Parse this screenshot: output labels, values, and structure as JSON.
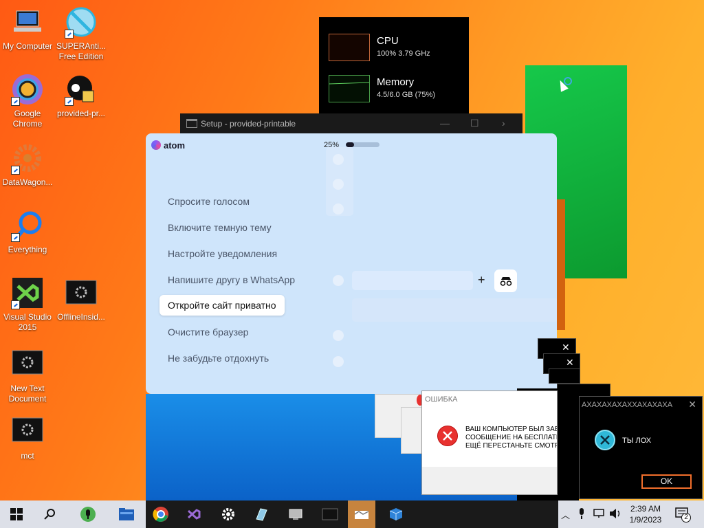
{
  "desktop": {
    "icons": [
      {
        "label": "My Computer"
      },
      {
        "label": "SUPERAnti... Free Edition"
      },
      {
        "label": "Google Chrome"
      },
      {
        "label": "provided-pr..."
      },
      {
        "label": "DataWagon..."
      },
      {
        "label": "Everything"
      },
      {
        "label": "Visual Studio 2015"
      },
      {
        "label": "OfflineInsid..."
      },
      {
        "label": "New Text Document"
      },
      {
        "label": "mct"
      }
    ]
  },
  "task_manager": {
    "cpu": {
      "title": "CPU",
      "detail": "100%  3.79 GHz"
    },
    "memory": {
      "title": "Memory",
      "detail": "4.5/6.0 GB (75%)"
    }
  },
  "setup_window": {
    "title": "Setup - provided-printable"
  },
  "atom": {
    "brand": "atom",
    "progress_label": "25%",
    "progress_value": 25,
    "tips": [
      "Спросите голосом",
      "Включите темную тему",
      "Настройте уведомления",
      "Напишите другу в WhatsApp",
      "Откройте сайт приватно",
      "Очистите браузер",
      "Не забудьте отдохнуть"
    ],
    "active_tip": 4
  },
  "error_dialog": {
    "title": "ОШИБКА",
    "message_lines": [
      "ВАШ КОМПЬЮТЕР БЫЛ ЗАБЛОКИ",
      "СООБЩЕНИЕ НА БЕСПЛАТНЫЙ",
      "ЕЩЁ ПЕРЕСТАНЬТЕ СМОТРЕТЬ П"
    ]
  },
  "laugh_dialog": {
    "title": "АХАХАХАХАХХАХАХАХА",
    "message": "ТЫ ЛОХ",
    "ok_label": "OK"
  },
  "taskbar": {
    "time": "2:39 AM",
    "date": "1/9/2023",
    "notification_count": "2"
  },
  "colors": {
    "accent_orange": "#f26f2c",
    "error_red": "#e8312f",
    "info_cyan": "#2fb8d8"
  }
}
